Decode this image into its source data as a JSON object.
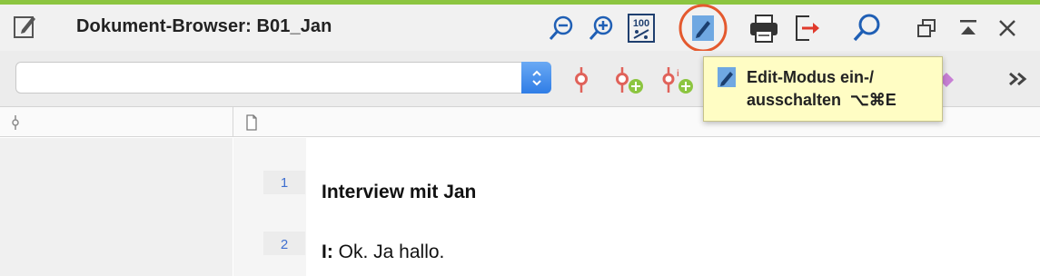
{
  "window": {
    "title": "Dokument-Browser: B01_Jan"
  },
  "toolbar": {
    "search_value": ""
  },
  "tooltip": {
    "line1": "Edit-Modus ein-/",
    "line2": "ausschalten  ⌥⌘E"
  },
  "document": {
    "lines": [
      {
        "number": "1",
        "prefix": "",
        "text": "Interview mit Jan"
      },
      {
        "number": "2",
        "prefix": "I:",
        "text": " Ok. Ja hallo."
      }
    ]
  },
  "colors": {
    "accent_green": "#8cc540",
    "highlight_ring": "#e4592e",
    "icon_blue": "#2a63b8",
    "code_red": "#e0625a",
    "line_number_blue": "#3f6fd0"
  }
}
